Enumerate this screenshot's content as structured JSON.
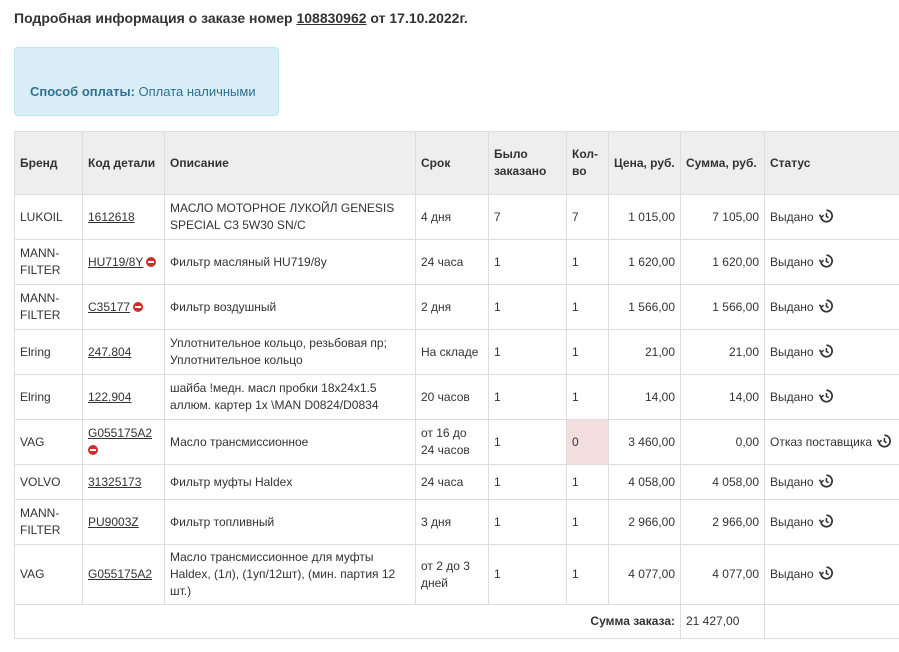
{
  "header": {
    "title_prefix": "Подробная информация о заказе номер ",
    "order_number": "108830962",
    "title_suffix": " от 17.10.2022г."
  },
  "payment": {
    "label": "Способ оплаты:",
    "value": " Оплата наличными"
  },
  "table": {
    "columns": [
      "Бренд",
      "Код детали",
      "Описание",
      "Срок",
      "Было заказано",
      "Кол-во",
      "Цена, руб.",
      "Сумма, руб.",
      "Статус"
    ],
    "rows": [
      {
        "brand": "LUKOIL",
        "code": "1612618",
        "description": "МАСЛО МОТОРНОЕ ЛУКОЙЛ GENESIS SPECIAL C3 5W30 SN/C",
        "term": "4 дня",
        "ordered": "7",
        "qty": "7",
        "price": "1 015,00",
        "sum": "7 105,00",
        "status": "Выдано"
      },
      {
        "brand": "MANN-FILTER",
        "code": "HU719/8Y",
        "description": "Фильтр масляный HU719/8y",
        "term": "24 часа",
        "ordered": "1",
        "qty": "1",
        "price": "1 620,00",
        "sum": "1 620,00",
        "status": "Выдано"
      },
      {
        "brand": "MANN-FILTER",
        "code": "C35177",
        "description": "Фильтр воздушный",
        "term": "2 дня",
        "ordered": "1",
        "qty": "1",
        "price": "1 566,00",
        "sum": "1 566,00",
        "status": "Выдано"
      },
      {
        "brand": "Elring",
        "code": "247.804",
        "description": "Уплотнительное кольцо, резьбовая пр; Уплотнительное кольцо",
        "term": "На складе",
        "ordered": "1",
        "qty": "1",
        "price": "21,00",
        "sum": "21,00",
        "status": "Выдано"
      },
      {
        "brand": "Elring",
        "code": "122.904",
        "description": "шайба !медн. масл пробки 18x24x1.5 аллюм. картер 1x \\MAN D0824/D0834",
        "term": "20 часов",
        "ordered": "1",
        "qty": "1",
        "price": "14,00",
        "sum": "14,00",
        "status": "Выдано"
      },
      {
        "brand": "VAG",
        "code": "G055175A2",
        "description": "Масло трансмиссионное",
        "term": "от 16 до 24 часов",
        "ordered": "1",
        "qty": "0",
        "price": "3 460,00",
        "sum": "0,00",
        "status": "Отказ поставщика"
      },
      {
        "brand": "VOLVO",
        "code": "31325173",
        "description": "Фильтр муфты Haldex",
        "term": "24 часа",
        "ordered": "1",
        "qty": "1",
        "price": "4 058,00",
        "sum": "4 058,00",
        "status": "Выдано"
      },
      {
        "brand": "MANN-FILTER",
        "code": "PU9003Z",
        "description": "Фильтр топливный",
        "term": "3 дня",
        "ordered": "1",
        "qty": "1",
        "price": "2 966,00",
        "sum": "2 966,00",
        "status": "Выдано"
      },
      {
        "brand": "VAG",
        "code": "G055175A2",
        "description": "Масло трансмиссионное для муфты Haldex, (1л), (1уп/12шт), (мин. партия 12 шт.)",
        "term": "от 2 до 3 дней",
        "ordered": "1",
        "qty": "1",
        "price": "4 077,00",
        "sum": "4 077,00",
        "status": "Выдано"
      }
    ],
    "total_label": "Сумма заказа:",
    "total_value": "21 427,00"
  },
  "icons": {
    "history": "history-icon",
    "unavailable": "minus-circle-icon"
  },
  "colors": {
    "info_bg": "#d9edf7",
    "info_text": "#31708f",
    "header_bg": "#eeeeee",
    "qty_zero_bg": "#f2dede",
    "remove_red": "#c9302c"
  }
}
